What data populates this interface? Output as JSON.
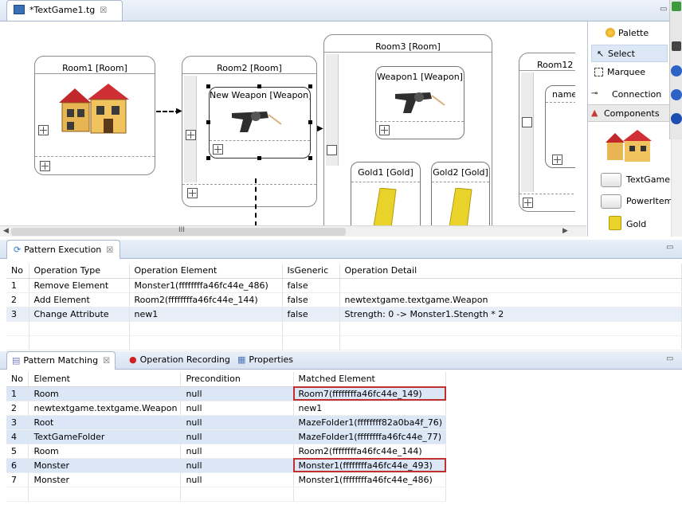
{
  "editor": {
    "tab_title": "*TextGame1.tg",
    "tab_close": "☒",
    "rooms": {
      "room1": "Room1 [Room]",
      "room2": "Room2 [Room]",
      "room3": "Room3 [Room]",
      "room12": "Room12",
      "name_partial": "name"
    },
    "items": {
      "new_weapon": "New Weapon [Weapon]",
      "weapon1": "Weapon1 [Weapon]",
      "gold1": "Gold1 [Gold]",
      "gold2": "Gold2 [Gold]"
    },
    "scroll_ellipsis": "III"
  },
  "palette": {
    "title": "Palette",
    "select": "Select",
    "marquee": "Marquee",
    "connection": "Connection",
    "components": "Components",
    "textgamefolder": "TextGameFol...",
    "poweritem": "PowerItem",
    "gold": "Gold"
  },
  "pattern_execution": {
    "tab_label": "Pattern Execution",
    "columns": [
      "No",
      "Operation Type",
      "Operation Element",
      "IsGeneric",
      "Operation Detail"
    ],
    "rows": [
      [
        "1",
        "Remove Element",
        "Monster1(ffffffffa46fc44e_486)",
        "false",
        ""
      ],
      [
        "2",
        "Add Element",
        "Room2(ffffffffa46fc44e_144)",
        "false",
        "newtextgame.textgame.Weapon"
      ],
      [
        "3",
        "Change Attribute",
        "new1",
        "false",
        "Strength: 0 -> Monster1.Stength * 2"
      ]
    ]
  },
  "bottom_tabs": {
    "pattern_matching": "Pattern Matching",
    "operation_recording": "Operation Recording",
    "properties": "Properties"
  },
  "pattern_matching": {
    "columns": [
      "No",
      "Element",
      "Precondition",
      "Matched Element"
    ],
    "rows": [
      [
        "1",
        "Room",
        "null",
        "Room7(ffffffffa46fc44e_149)"
      ],
      [
        "2",
        "newtextgame.textgame.Weapon",
        "null",
        "new1"
      ],
      [
        "3",
        "Root",
        "null",
        "MazeFolder1(ffffffff82a0ba4f_76)"
      ],
      [
        "4",
        "TextGameFolder",
        "null",
        "MazeFolder1(ffffffffa46fc44e_77)"
      ],
      [
        "5",
        "Room",
        "null",
        "Room2(ffffffffa46fc44e_144)"
      ],
      [
        "6",
        "Monster",
        "null",
        "Monster1(ffffffffa46fc44e_493)"
      ],
      [
        "7",
        "Monster",
        "null",
        "Monster1(ffffffffa46fc44e_486)"
      ]
    ]
  }
}
